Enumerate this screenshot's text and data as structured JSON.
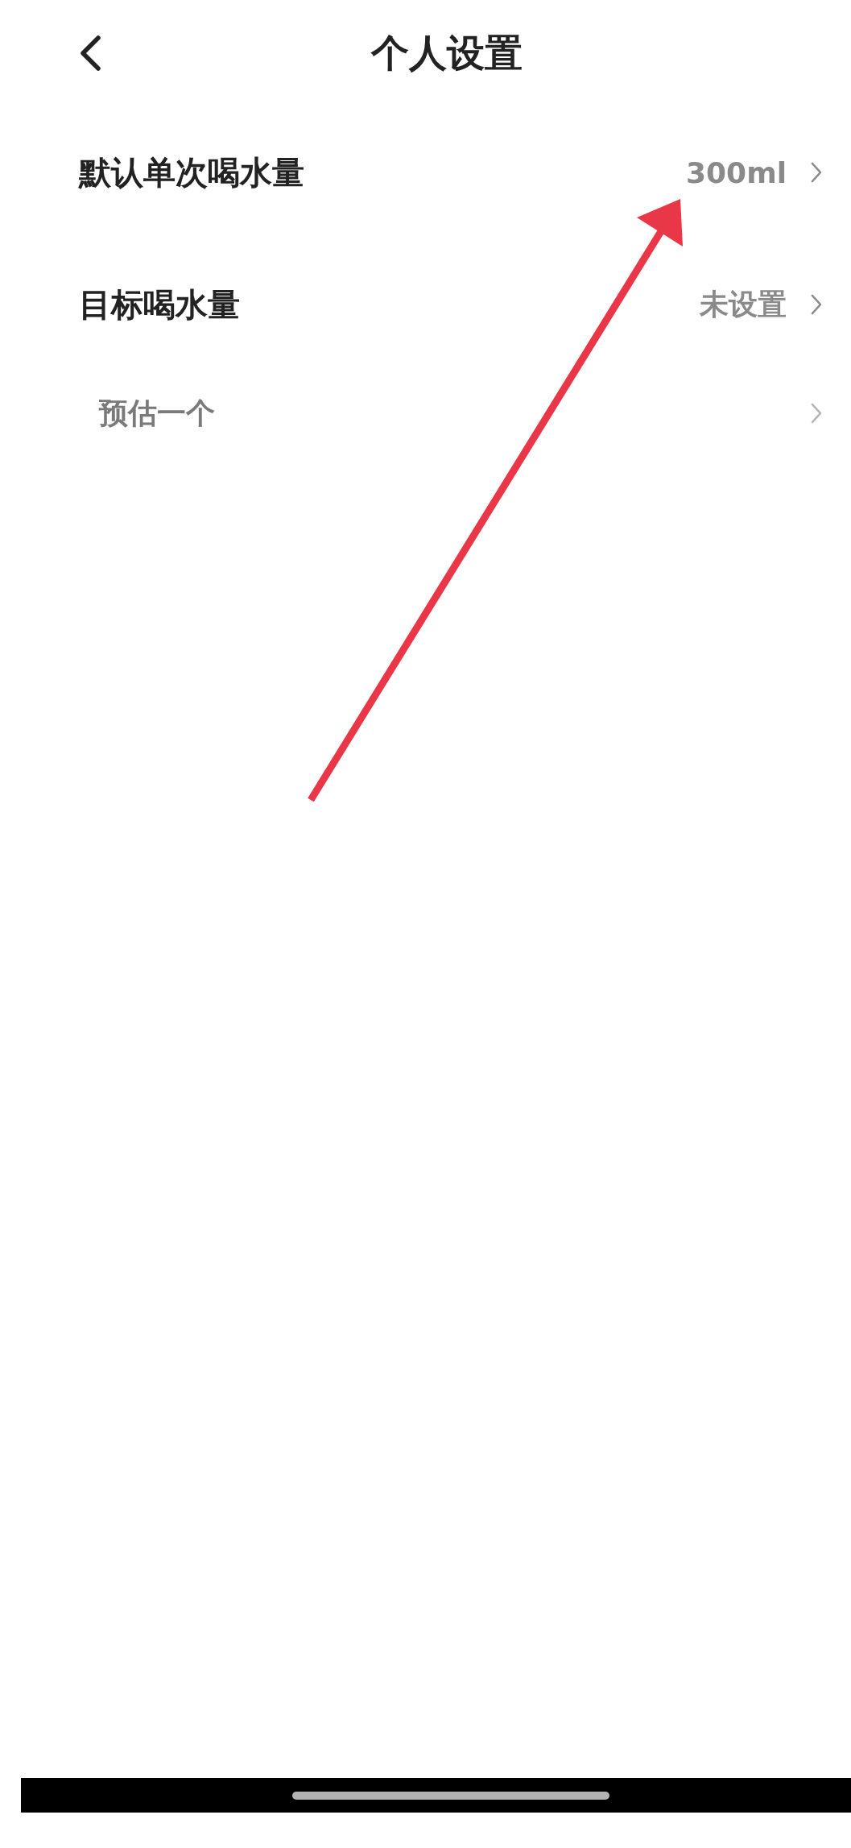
{
  "header": {
    "title": "个人设置"
  },
  "rows": [
    {
      "kind": "main",
      "label": "默认单次喝水量",
      "value": "300ml"
    },
    {
      "kind": "main",
      "label": "目标喝水量",
      "value": "未设置"
    },
    {
      "kind": "sub",
      "label": "预估一个"
    }
  ],
  "annotations": [
    {
      "kind": "arrow"
    }
  ]
}
